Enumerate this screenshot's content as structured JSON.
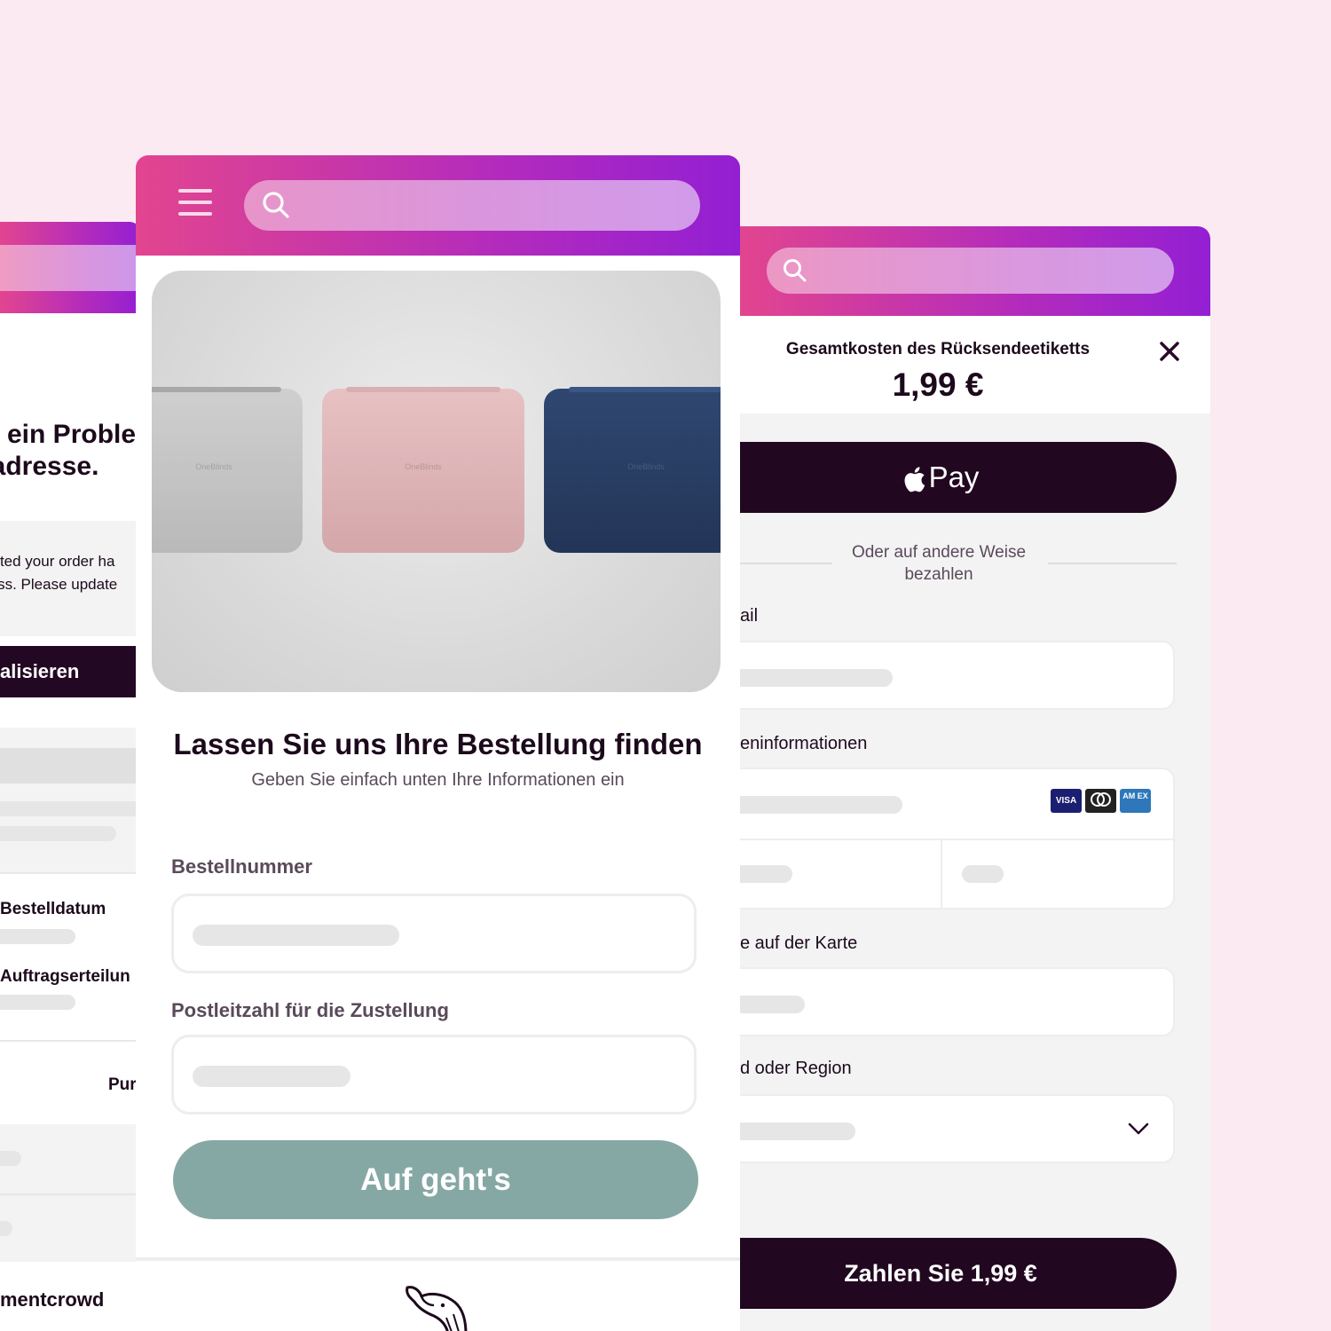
{
  "left_panel": {
    "heading_line1": "ein Proble",
    "heading_line2": "radresse.",
    "message_line1": "ected your order ha",
    "message_line2": "ress. Please update",
    "update_button": "alisieren",
    "order_date_label": "Bestelldatum",
    "order_placed_label": "Auftragserteilun",
    "purchase_label": "Pur",
    "brand_footer": "mentcrowd"
  },
  "center_panel": {
    "title": "Lassen Sie uns Ihre Bestellung finden",
    "subtitle": "Geben Sie einfach unten Ihre Informationen ein",
    "order_number_label": "Bestellnummer",
    "postcode_label": "Postleitzahl für die Zustellung",
    "submit_button": "Auf geht's",
    "product_brand": "OneBlinds"
  },
  "right_panel": {
    "cost_caption": "Gesamtkosten des Rücksendeetiketts",
    "cost_amount": "1,99 €",
    "apple_pay_label": "Pay",
    "or_pay_text": "Oder auf andere Weise bezahlen",
    "email_label": "ail",
    "card_info_label": "eninformationen",
    "card_name_label": "e auf der Karte",
    "country_label": "d oder Region",
    "pay_button": "Zahlen Sie 1,99 €",
    "card_brands": [
      "VISA",
      "",
      "AM EX"
    ]
  },
  "colors": {
    "background": "#fbeaf1",
    "gradient_start": "#e2458f",
    "gradient_end": "#931fd3",
    "dark_button": "#220720",
    "submit_button": "#86a8a5"
  },
  "icons": [
    "hamburger-icon",
    "search-icon",
    "close-icon",
    "apple-icon",
    "chevron-down-icon",
    "whale-logo-icon"
  ]
}
